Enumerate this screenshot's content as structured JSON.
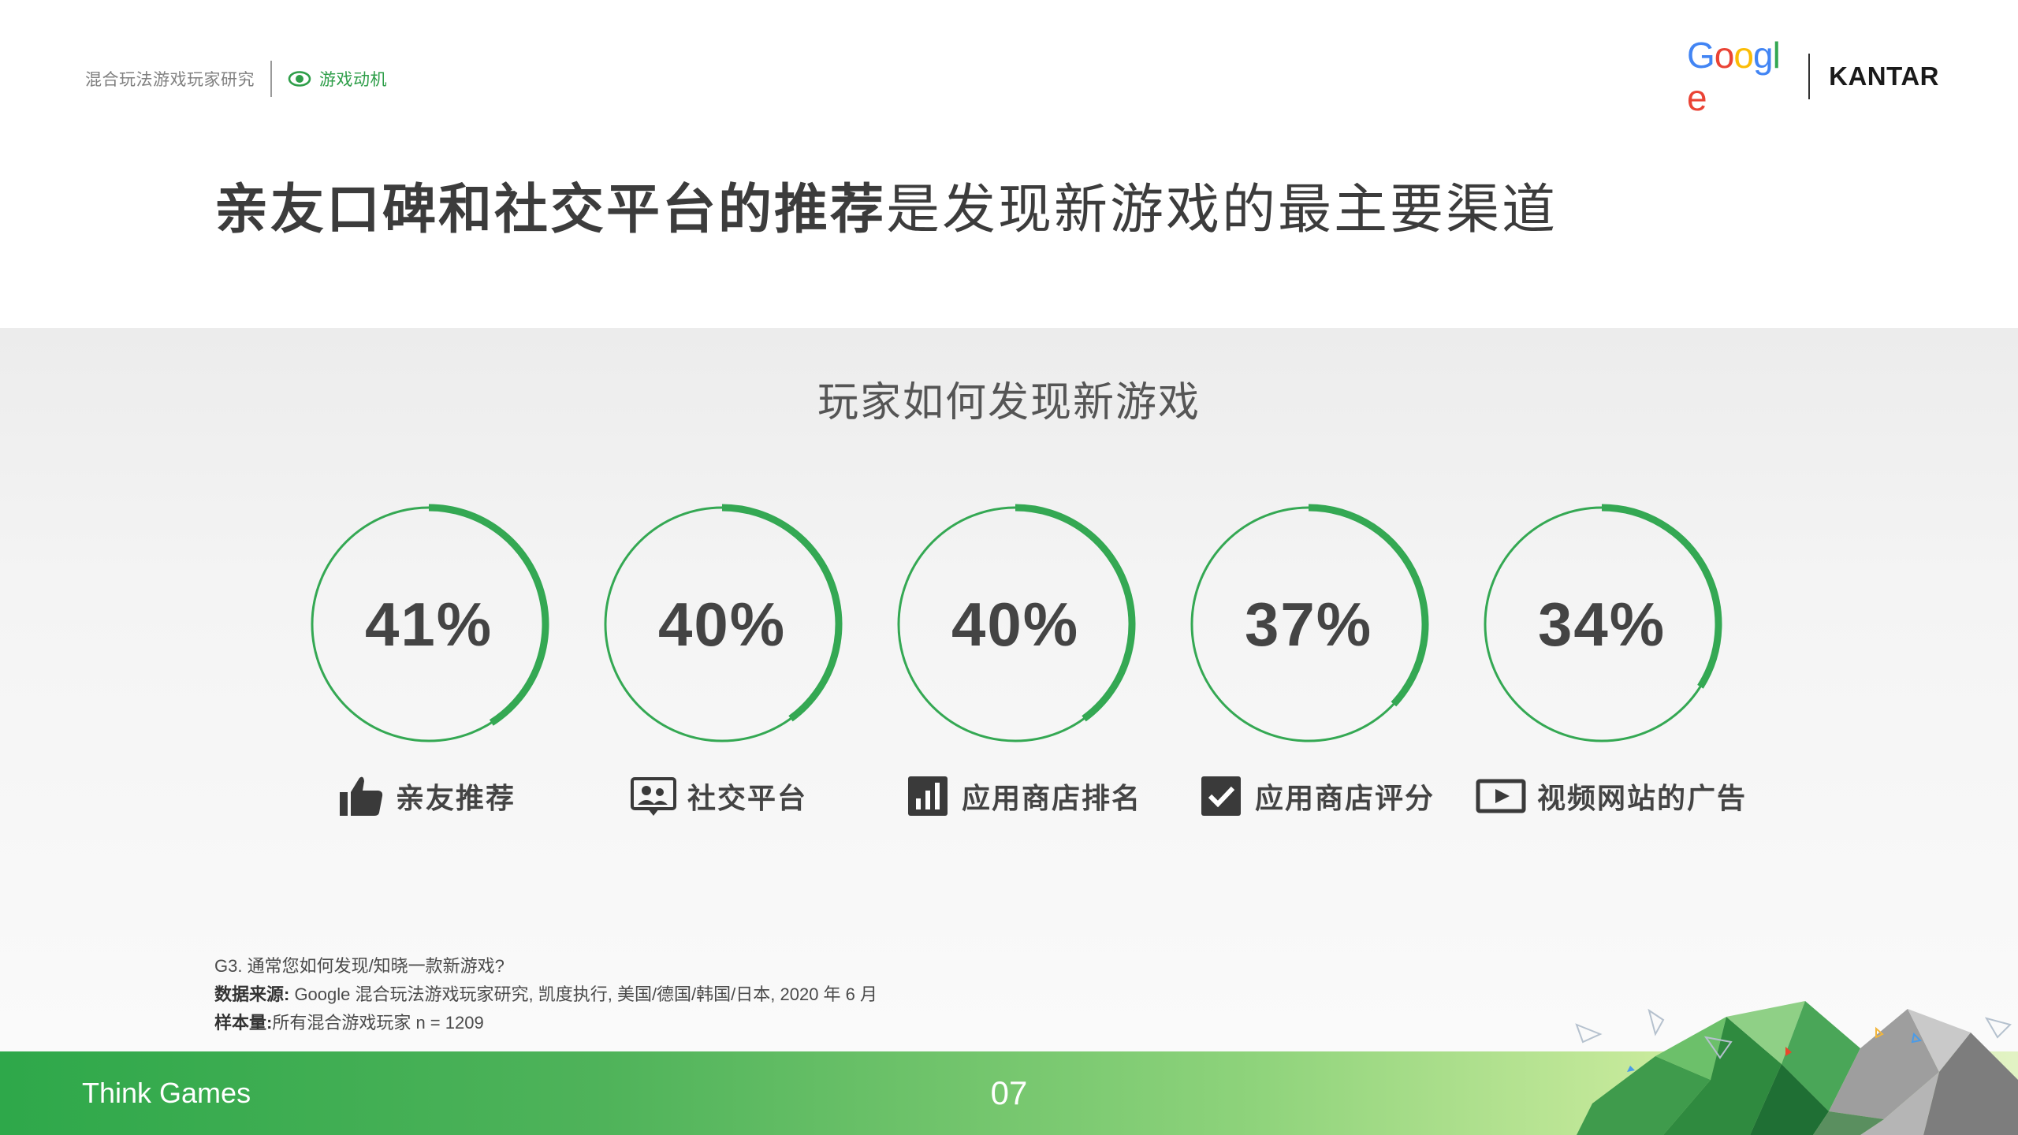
{
  "header": {
    "study_title": "混合玩法游戏玩家研究",
    "section": "游戏动机",
    "section_icon": "eye-icon",
    "logos": {
      "google": "Google",
      "kantar": "KANTAR"
    }
  },
  "headline": {
    "bold": "亲友口碑和社交平台的推荐",
    "regular": "是发现新游戏的最主要渠道"
  },
  "subtitle": "玩家如何发现新游戏",
  "colors": {
    "accent": "#2e9e49",
    "ring": "#34a853"
  },
  "metrics": [
    {
      "value": "41%",
      "fraction": 0.41,
      "label": "亲友推荐",
      "icon": "thumbs-up-icon"
    },
    {
      "value": "40%",
      "fraction": 0.4,
      "label": "社交平台",
      "icon": "social-people-icon"
    },
    {
      "value": "40%",
      "fraction": 0.4,
      "label": "应用商店排名",
      "icon": "bar-chart-icon"
    },
    {
      "value": "37%",
      "fraction": 0.37,
      "label": "应用商店评分",
      "icon": "checkbox-icon"
    },
    {
      "value": "34%",
      "fraction": 0.34,
      "label": "视频网站的广告",
      "icon": "video-play-icon"
    }
  ],
  "notes": {
    "question": "G3. 通常您如何发现/知晓一款新游戏?",
    "source_label": "数据来源:",
    "source": " Google 混合玩法游戏玩家研究, 凯度执行, 美国/德国/韩国/日本, 2020 年 6 月",
    "sample_label": "样本量:",
    "sample": "所有混合游戏玩家 n = 1209"
  },
  "footer": {
    "brand": "Think Games",
    "page": "07"
  }
}
